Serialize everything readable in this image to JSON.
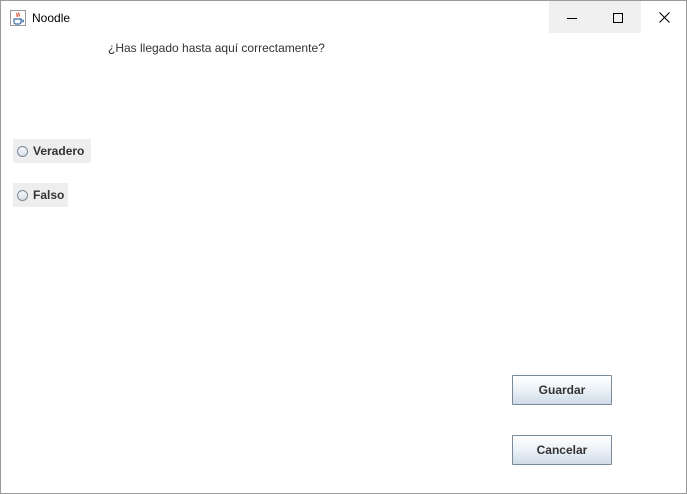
{
  "window": {
    "title": "Noodle",
    "app_icon": "java-cup-icon",
    "controls": {
      "minimize_icon": "minimize-icon",
      "maximize_icon": "maximize-icon",
      "close_icon": "close-icon"
    }
  },
  "question": {
    "text": "¿Has llegado hasta aquí correctamente?"
  },
  "options": [
    {
      "label": "Veradero",
      "selected": false
    },
    {
      "label": "Falso",
      "selected": false
    }
  ],
  "buttons": {
    "save_label": "Guardar",
    "cancel_label": "Cancelar"
  },
  "colors": {
    "window_background": "#ffffff",
    "radio_background": "#eeeeee",
    "button_border": "#7a8a99",
    "text": "#333333"
  }
}
